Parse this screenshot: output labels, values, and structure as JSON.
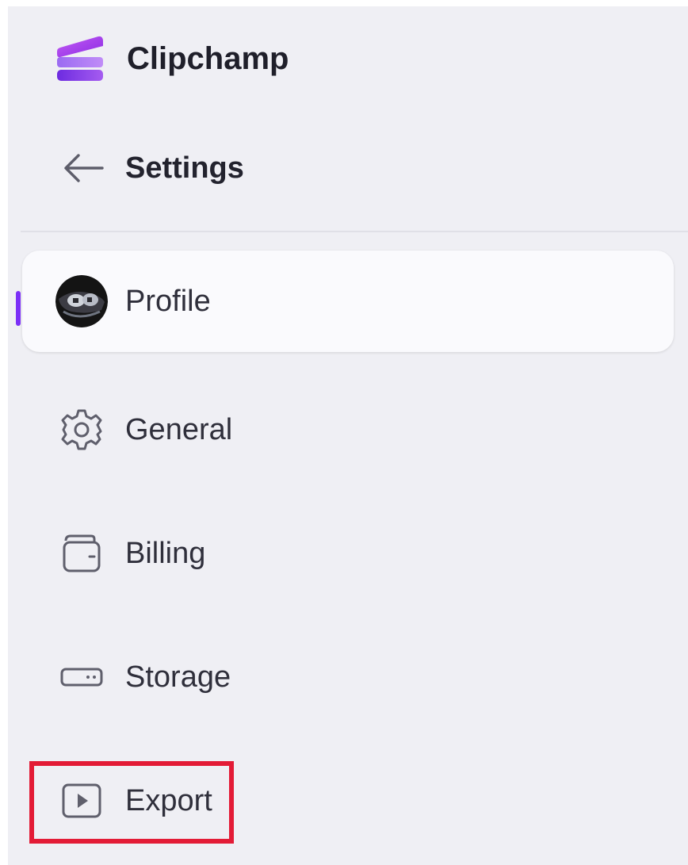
{
  "app": {
    "name": "Clipchamp",
    "logo_icon": "clipchamp-logo-icon"
  },
  "header": {
    "back_icon": "arrow-left-icon",
    "title": "Settings"
  },
  "nav": {
    "active_index": 0,
    "items": [
      {
        "label": "Profile",
        "icon": "avatar-image"
      },
      {
        "label": "General",
        "icon": "gear-icon"
      },
      {
        "label": "Billing",
        "icon": "wallet-icon"
      },
      {
        "label": "Storage",
        "icon": "storage-icon"
      },
      {
        "label": "Export",
        "icon": "play-box-icon"
      }
    ]
  },
  "colors": {
    "accent": "#7b2ff7",
    "highlight": "#e31b36",
    "sidebar_bg": "#efeff4",
    "active_bg": "#fafafd"
  }
}
